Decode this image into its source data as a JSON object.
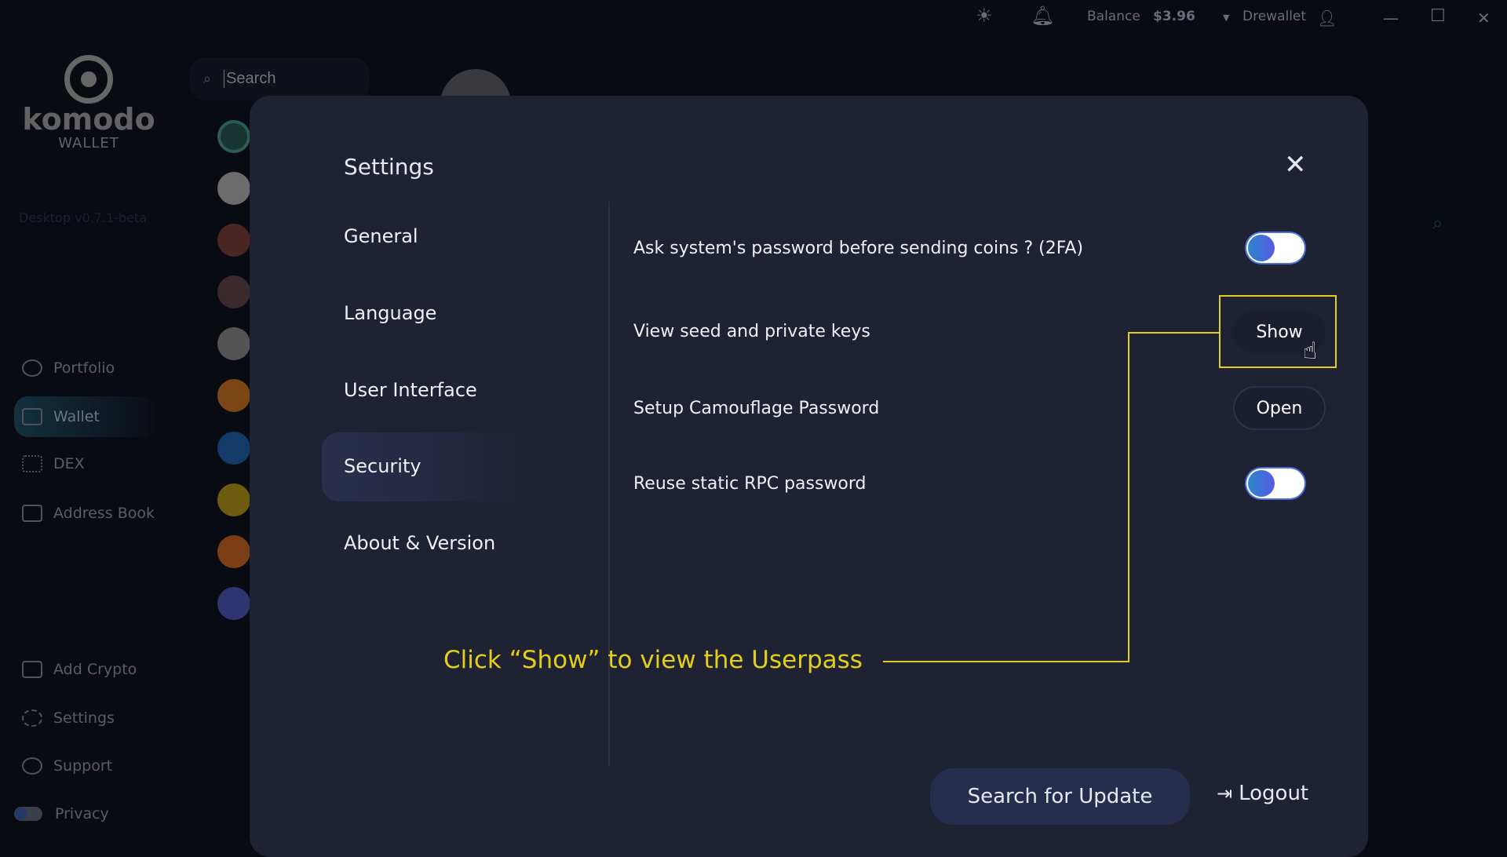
{
  "topbar": {
    "balance_label": "Balance",
    "balance_value": "$3.96",
    "wallet_name": "Drewallet"
  },
  "logo": {
    "name": "komodo",
    "sub": "WALLET",
    "version": "Desktop v0.7.1-beta"
  },
  "search": {
    "placeholder": "Search"
  },
  "sidebar": {
    "items": [
      {
        "label": "Portfolio"
      },
      {
        "label": "Wallet"
      },
      {
        "label": "DEX"
      },
      {
        "label": "Address Book"
      },
      {
        "label": "Add Crypto"
      },
      {
        "label": "Settings"
      },
      {
        "label": "Support"
      },
      {
        "label": "Privacy"
      }
    ],
    "active": "Wallet"
  },
  "coins": [
    "komodo",
    "panda",
    "avatar-1",
    "avatar-2",
    "litecoin",
    "bitcoin",
    "digibyte",
    "coin-yellow",
    "shiba",
    "ethereum"
  ],
  "dialog": {
    "title": "Settings",
    "menu": [
      {
        "label": "General"
      },
      {
        "label": "Language"
      },
      {
        "label": "User Interface"
      },
      {
        "label": "Security"
      },
      {
        "label": "About & Version"
      }
    ],
    "active_menu": "Security",
    "rows": [
      {
        "label": "Ask system's password before sending coins ? (2FA)",
        "type": "toggle",
        "on": true
      },
      {
        "label": "View seed and private keys",
        "type": "button",
        "button": "Show"
      },
      {
        "label": "Setup Camouflage Password",
        "type": "button",
        "button": "Open"
      },
      {
        "label": "Reuse static RPC password",
        "type": "toggle",
        "on": true
      }
    ],
    "search_update": "Search for Update",
    "logout": "Logout"
  },
  "annotation": {
    "text": "Click “Show” to view the Userpass",
    "color": "#e3cf1a"
  },
  "colors": {
    "accent": "#5a5ae6",
    "dialog_bg": "#1f2233",
    "background": "#090b12"
  }
}
